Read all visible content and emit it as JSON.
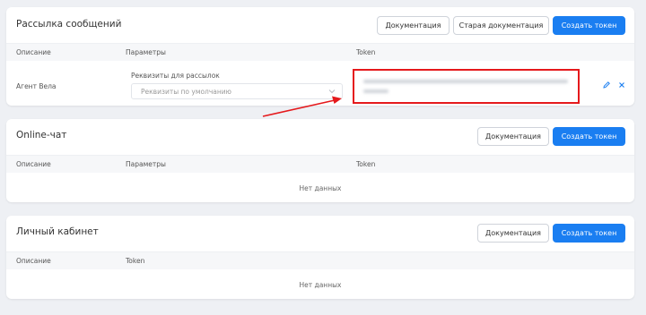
{
  "mailing": {
    "title": "Рассылка сообщений",
    "btn_docs": "Документация",
    "btn_old_docs": "Старая документация",
    "btn_create": "Создать токен",
    "columns": {
      "desc": "Описание",
      "params": "Параметры",
      "token": "Token"
    },
    "row": {
      "description": "Агент Вела",
      "params_label": "Реквизиты для рассылок",
      "params_value": "Реквизиты по умолчанию"
    }
  },
  "online_chat": {
    "title": "Online-чат",
    "btn_docs": "Документация",
    "btn_create": "Создать токен",
    "columns": {
      "desc": "Описание",
      "params": "Параметры",
      "token": "Token"
    },
    "empty": "Нет данных"
  },
  "cabinet": {
    "title": "Личный кабинет",
    "btn_docs": "Документация",
    "btn_create": "Создать токен",
    "columns": {
      "desc": "Описание",
      "token": "Token"
    },
    "empty": "Нет данных"
  },
  "colors": {
    "primary": "#1a7ef1",
    "highlight": "#e5191c"
  },
  "icons": {
    "edit": "pencil-icon",
    "delete": "close-icon",
    "select": "chevron-down-icon"
  }
}
